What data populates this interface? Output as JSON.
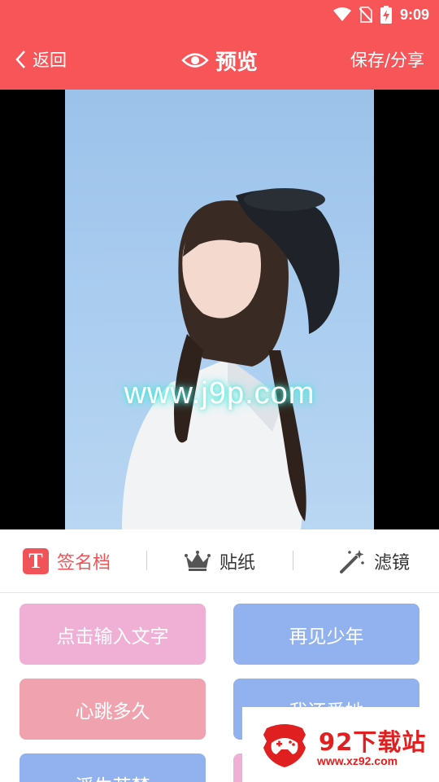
{
  "status": {
    "time": "9:09"
  },
  "header": {
    "back_label": "返回",
    "title": "预览",
    "save_label": "保存/分享"
  },
  "preview": {
    "watermark": "www.j9p.com"
  },
  "tabs": [
    {
      "label": "签名档",
      "icon": "text-icon",
      "active": true
    },
    {
      "label": "贴纸",
      "icon": "crown-icon",
      "active": false
    },
    {
      "label": "滤镜",
      "icon": "magic-wand-icon",
      "active": false
    }
  ],
  "templates": [
    {
      "label": "点击输入文字",
      "color": "#f0afd5"
    },
    {
      "label": "再见少年",
      "color": "#92b1ef"
    },
    {
      "label": "心跳多久",
      "color": "#f0a2ae"
    },
    {
      "label": "我还爱她",
      "color": "#92b1ef"
    },
    {
      "label": "浮生若梦",
      "color": "#92b1ef"
    },
    {
      "label": "",
      "color": "#f0afd5"
    }
  ],
  "site_logo": {
    "name": "92下载站",
    "url": "www.xz92.com"
  },
  "colors": {
    "accent": "#f75558",
    "active_tab": "#f05458"
  }
}
